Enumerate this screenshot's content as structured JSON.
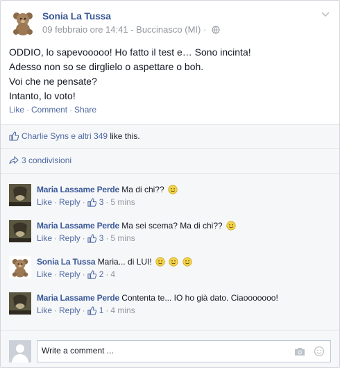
{
  "post": {
    "author": "Sonia La Tussa",
    "meta": "09 febbraio ore 14:41 - Buccinasco (MI) ·",
    "lines": [
      "ODDIO, lo sapevooooo! Ho fatto il test e… Sono incinta!",
      "Adesso non so se dirglielo o aspettare o boh.",
      "Voi che ne pensate?",
      "Intanto, lo voto!"
    ],
    "actions": {
      "like": "Like",
      "comment": "Comment",
      "share": "Share"
    },
    "likes": {
      "names": "Charlie Syns e altri 349",
      "suffix": " like this."
    },
    "shares": "3 condivisioni"
  },
  "comments": [
    {
      "author": "Maria Lassame Perde",
      "text": "Ma di chi??",
      "emojis": 1,
      "like": "Like",
      "reply": "Reply",
      "likes": "3",
      "time": "5 mins"
    },
    {
      "author": "Maria Lassame Perde",
      "text": "Ma sei scema? Ma di chi??",
      "emojis": 1,
      "like": "Like",
      "reply": "Reply",
      "likes": "3",
      "time": "5 mins"
    },
    {
      "author": "Sonia La Tussa",
      "text": "Maria... di LUI!",
      "emojis": 3,
      "like": "Like",
      "reply": "Reply",
      "likes": "2",
      "time": "4"
    },
    {
      "author": "Maria Lassame Perde",
      "text": "Contenta te... IO ho già dato. Ciaooooooo!",
      "emojis": 0,
      "like": "Like",
      "reply": "Reply",
      "likes": "1",
      "time": "4 mins"
    }
  ],
  "composer": {
    "placeholder": "Write a comment ..."
  },
  "colors": {
    "link": "#4e69a2",
    "author": "#3b5998",
    "muted": "#90949c"
  }
}
